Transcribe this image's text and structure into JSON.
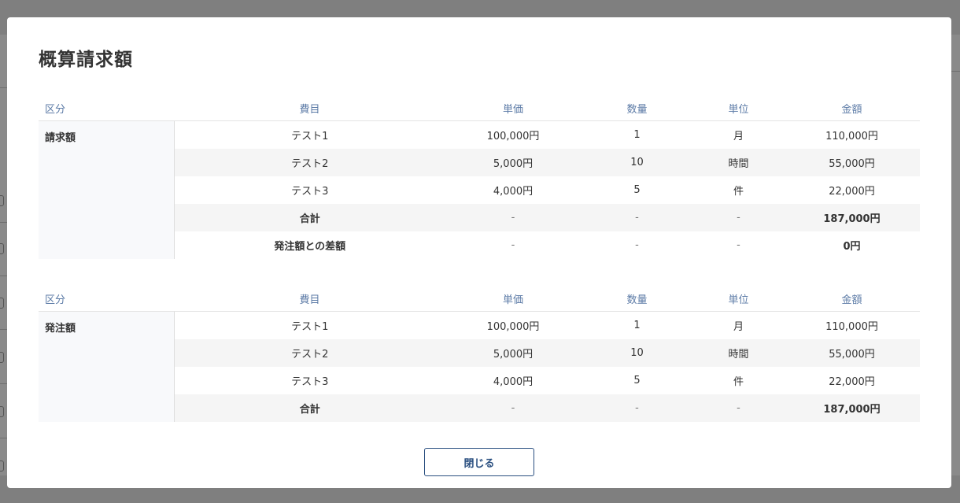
{
  "modal": {
    "title": "概算請求額",
    "close_label": "閉じる"
  },
  "columns": {
    "category": "区分",
    "item": "費目",
    "unit_price": "単価",
    "quantity": "数量",
    "unit": "単位",
    "amount": "金額"
  },
  "billing": {
    "category": "請求額",
    "rows": [
      {
        "item": "テスト1",
        "unit_price": "100,000円",
        "quantity": "1",
        "unit": "月",
        "amount": "110,000円"
      },
      {
        "item": "テスト2",
        "unit_price": "5,000円",
        "quantity": "10",
        "unit": "時間",
        "amount": "55,000円"
      },
      {
        "item": "テスト3",
        "unit_price": "4,000円",
        "quantity": "5",
        "unit": "件",
        "amount": "22,000円"
      }
    ],
    "total": {
      "item": "合計",
      "unit_price": "-",
      "quantity": "-",
      "unit": "-",
      "amount": "187,000円"
    },
    "diff": {
      "item": "発注額との差額",
      "unit_price": "-",
      "quantity": "-",
      "unit": "-",
      "amount": "0円"
    }
  },
  "order": {
    "category": "発注額",
    "rows": [
      {
        "item": "テスト1",
        "unit_price": "100,000円",
        "quantity": "1",
        "unit": "月",
        "amount": "110,000円"
      },
      {
        "item": "テスト2",
        "unit_price": "5,000円",
        "quantity": "10",
        "unit": "時間",
        "amount": "55,000円"
      },
      {
        "item": "テスト3",
        "unit_price": "4,000円",
        "quantity": "5",
        "unit": "件",
        "amount": "22,000円"
      }
    ],
    "total": {
      "item": "合計",
      "unit_price": "-",
      "quantity": "-",
      "unit": "-",
      "amount": "187,000円"
    }
  }
}
